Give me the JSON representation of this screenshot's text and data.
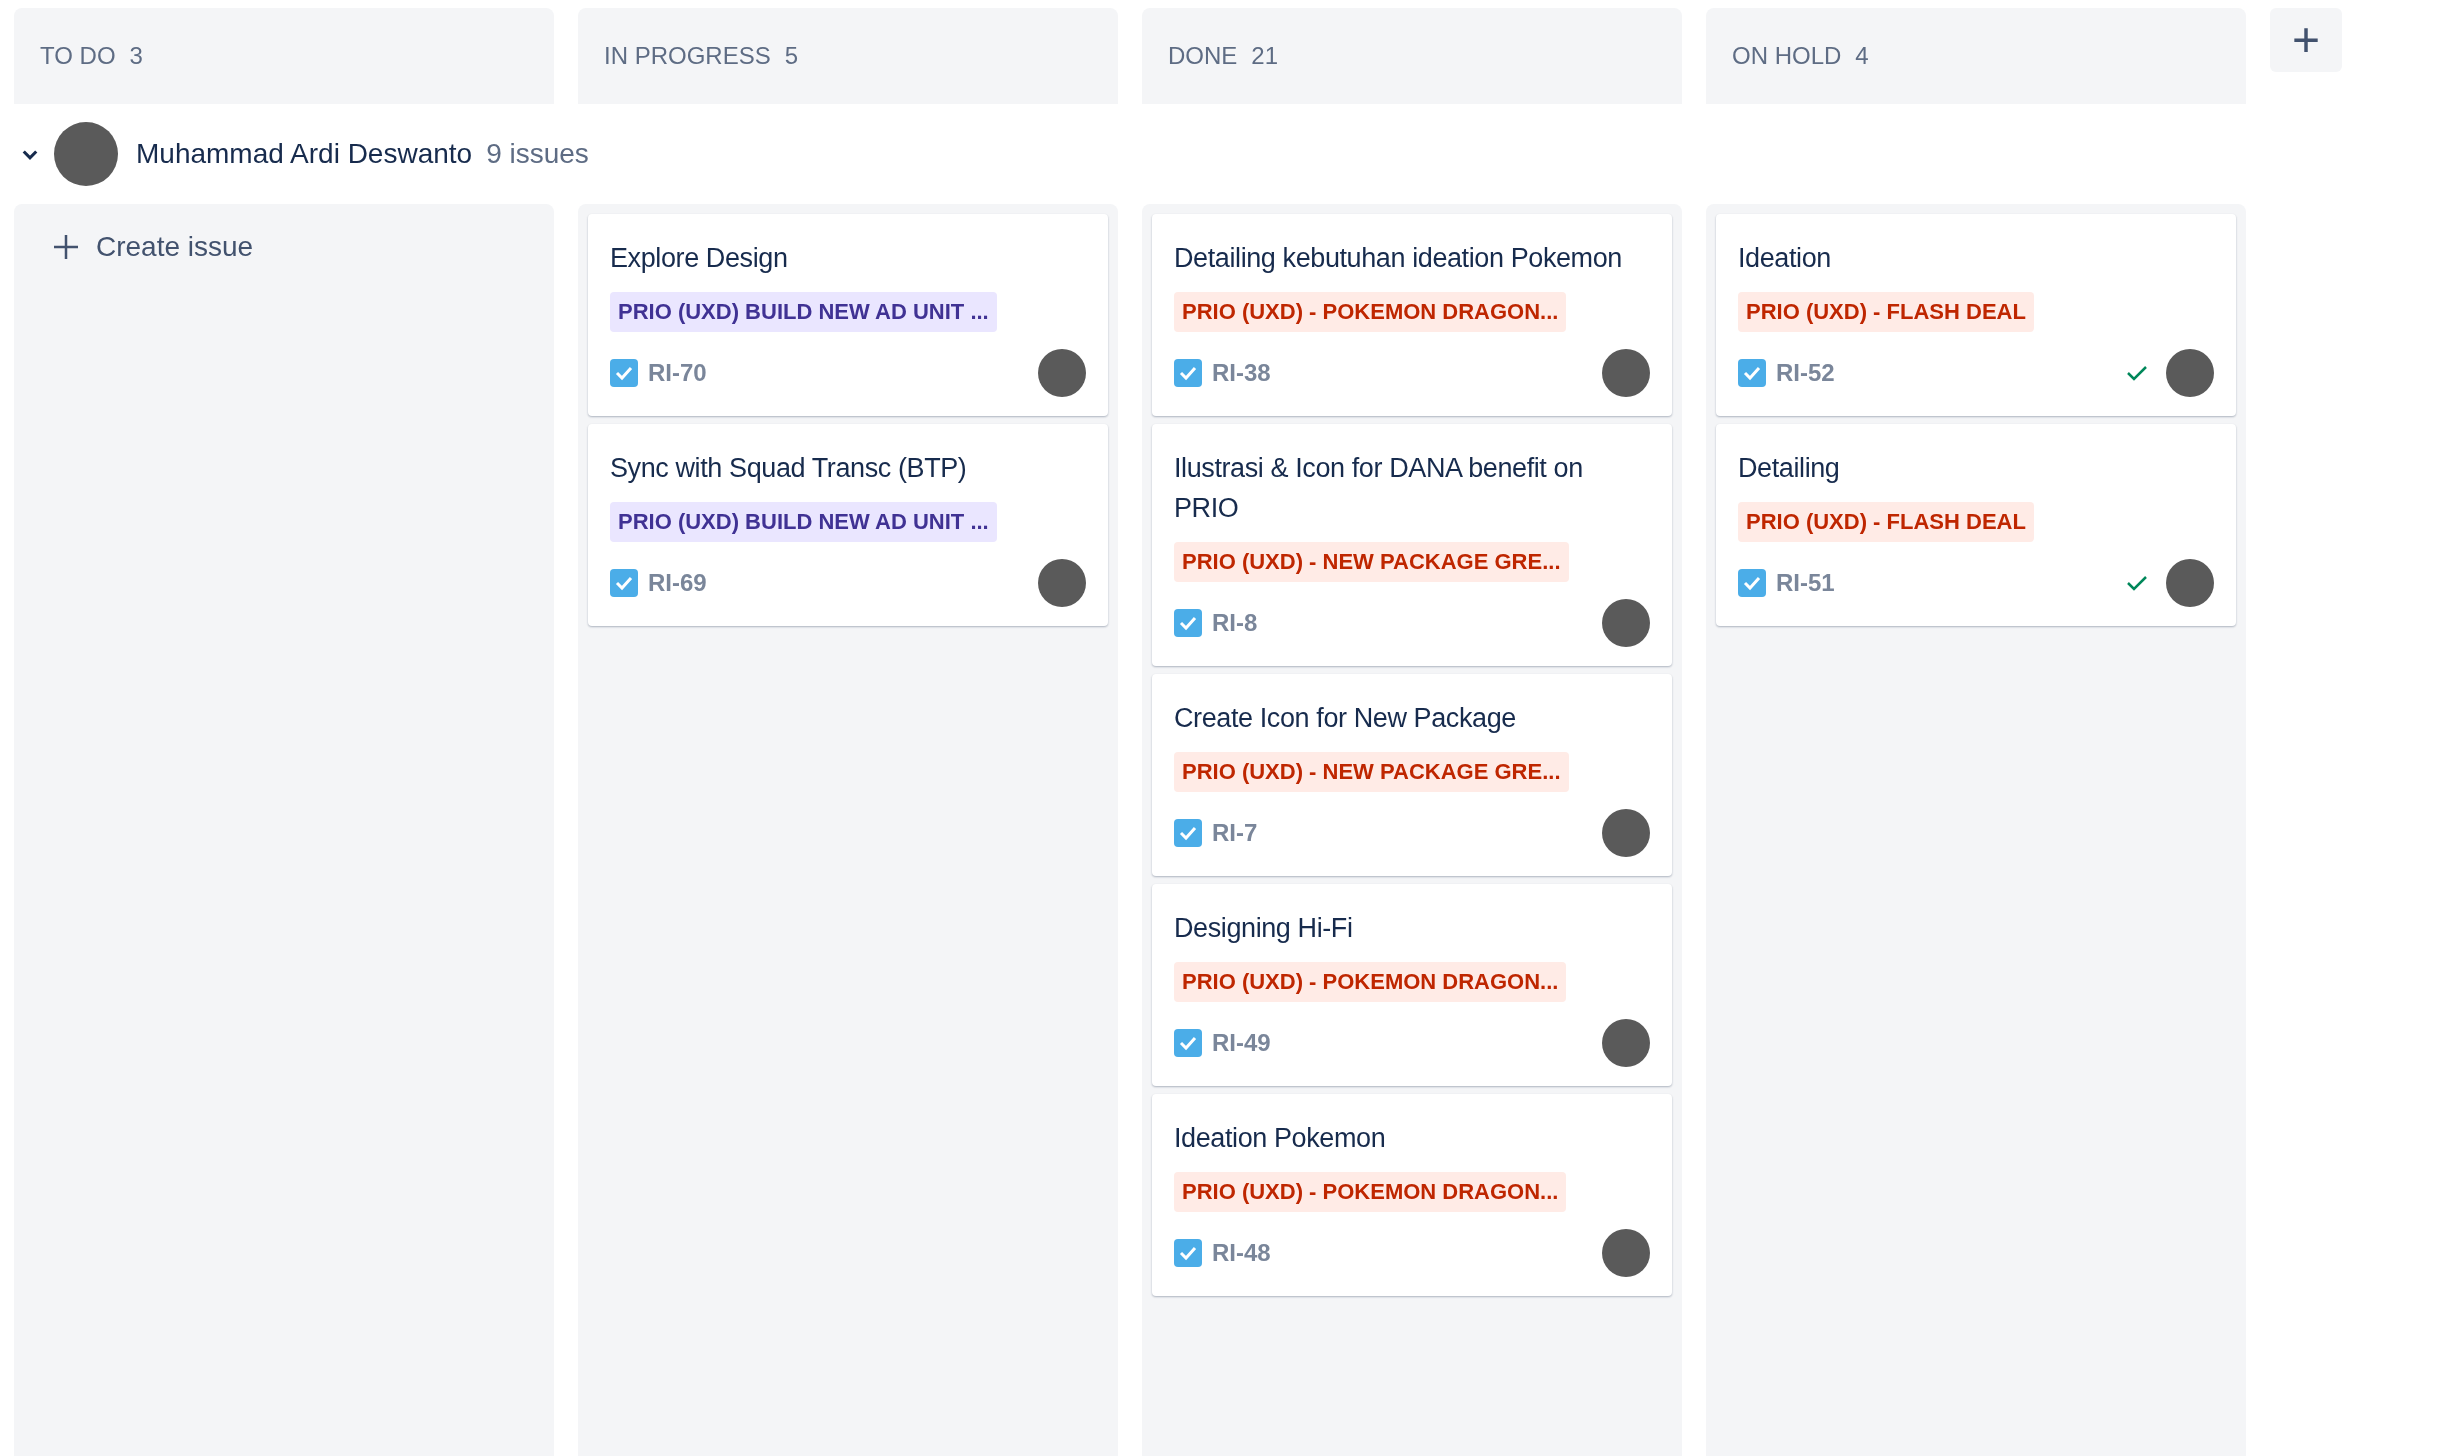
{
  "columns": [
    {
      "title": "TO DO",
      "count": "3"
    },
    {
      "title": "IN PROGRESS",
      "count": "5"
    },
    {
      "title": "DONE",
      "count": "21"
    },
    {
      "title": "ON HOLD",
      "count": "4"
    }
  ],
  "add_column_button": "+",
  "swimlane": {
    "expanded": true,
    "name": "Muhammad Ardi Deswanto",
    "count": "9 issues"
  },
  "create_issue": "Create issue",
  "lanes": [
    [
      {
        "title": "Explore Design",
        "epic": "PRIO (UXD) BUILD NEW AD UNIT ...",
        "color": "#403294",
        "key": "RI-70",
        "resolved": false
      },
      {
        "title": "Sync with Squad Transc (BTP)",
        "epic": "PRIO (UXD) BUILD NEW AD UNIT ...",
        "color": "#403294",
        "key": "RI-69",
        "resolved": false
      }
    ],
    [
      {
        "title": "Detailing kebutuhan ideation Pokemon",
        "epic": "PRIO (UXD) - POKEMON DRAGON...",
        "color": "#bf2600",
        "key": "RI-38",
        "resolved": false
      },
      {
        "title": "Ilustrasi & Icon for DANA benefit on PRIO",
        "epic": "PRIO (UXD) - NEW PACKAGE GRE...",
        "color": "#bf2600",
        "key": "RI-8",
        "resolved": false
      },
      {
        "title": "Create Icon for New Package",
        "epic": "PRIO (UXD) - NEW PACKAGE GRE...",
        "color": "#bf2600",
        "key": "RI-7",
        "resolved": false
      },
      {
        "title": "Designing Hi-Fi",
        "epic": "PRIO (UXD) - POKEMON DRAGON...",
        "color": "#bf2600",
        "key": "RI-49",
        "resolved": false
      },
      {
        "title": "Ideation Pokemon",
        "epic": "PRIO (UXD) - POKEMON DRAGON...",
        "color": "#bf2600",
        "key": "RI-48",
        "resolved": false
      }
    ],
    [
      {
        "title": "Ideation",
        "epic": "PRIO (UXD) - FLASH DEAL",
        "color": "#bf2600",
        "key": "RI-52",
        "resolved": true
      },
      {
        "title": "Detailing",
        "epic": "PRIO (UXD) - FLASH DEAL",
        "color": "#bf2600",
        "key": "RI-51",
        "resolved": true
      }
    ]
  ]
}
